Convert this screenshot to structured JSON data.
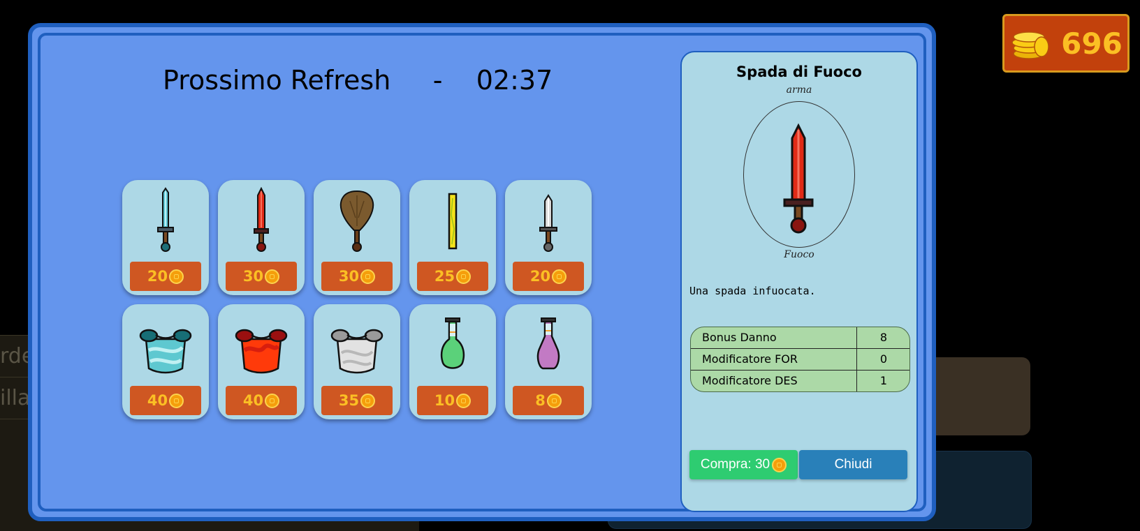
{
  "currency": {
    "amount": "696",
    "icon": "coins-stack-icon",
    "color": "#fbbf24"
  },
  "shop": {
    "refresh_label": "Prossimo Refresh",
    "separator": "-",
    "refresh_time": "02:37",
    "items": [
      {
        "icon": "sword-cyan-icon",
        "price": "20"
      },
      {
        "icon": "sword-red-icon",
        "price": "30"
      },
      {
        "icon": "wooden-club-icon",
        "price": "30"
      },
      {
        "icon": "yellow-staff-icon",
        "price": "25"
      },
      {
        "icon": "dagger-silver-icon",
        "price": "20"
      },
      {
        "icon": "armor-cyan-icon",
        "price": "40"
      },
      {
        "icon": "armor-red-icon",
        "price": "40"
      },
      {
        "icon": "armor-silver-icon",
        "price": "35"
      },
      {
        "icon": "potion-green-icon",
        "price": "10"
      },
      {
        "icon": "potion-purple-icon",
        "price": "8"
      }
    ]
  },
  "detail": {
    "name": "Spada di Fuoco",
    "type": "arma",
    "element": "Fuoco",
    "description": "Una spada infuocata.",
    "stats": [
      {
        "label": "Bonus Danno",
        "value": "8"
      },
      {
        "label": "Modificatore FOR",
        "value": "0"
      },
      {
        "label": "Modificatore DES",
        "value": "1"
      }
    ],
    "buy_label": "Compra: 30",
    "close_label": "Chiudi"
  },
  "background": {
    "left_text_1": "rde",
    "left_text_2": "illa"
  }
}
